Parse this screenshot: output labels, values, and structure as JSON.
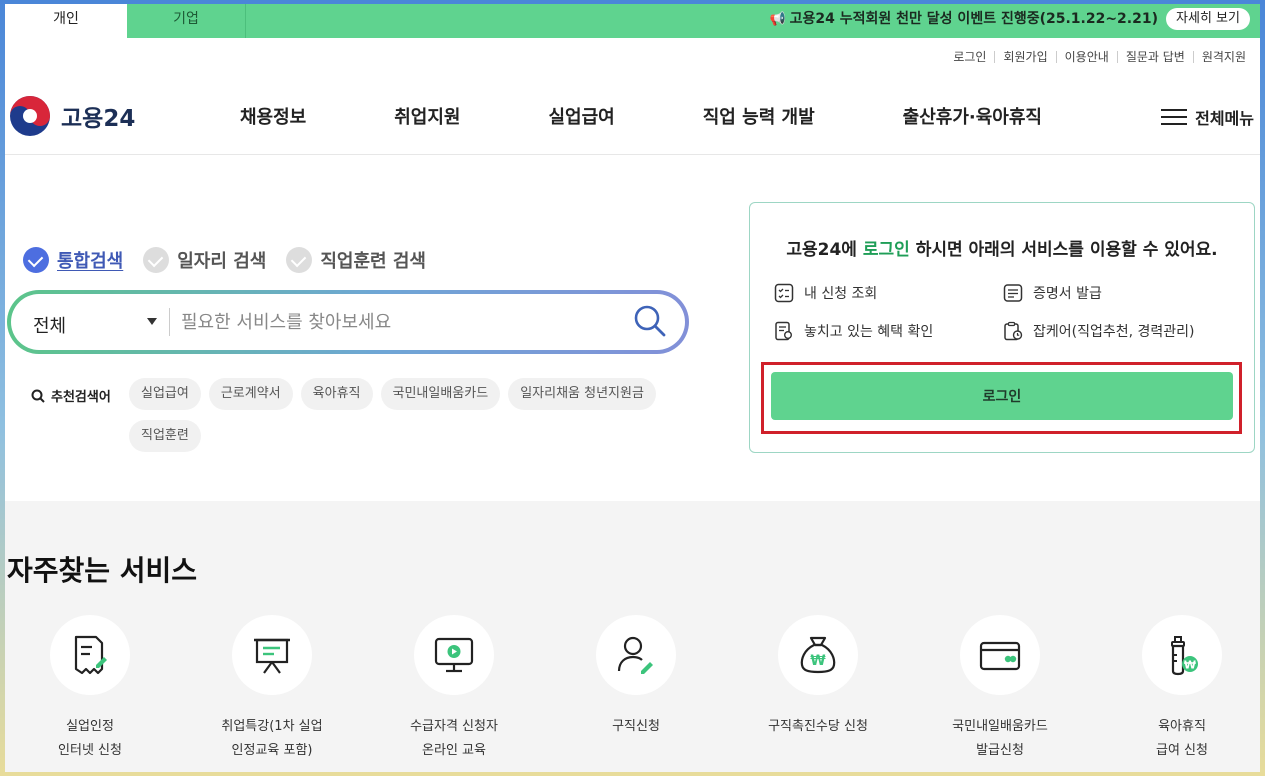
{
  "topbar": {
    "tab_person": "개인",
    "tab_company": "기업",
    "event_text": "고용24 누적회원 천만 달성 이벤트 진행중(25.1.22~2.21)",
    "event_button": "자세히 보기"
  },
  "util_links": [
    "로그인",
    "회원가입",
    "이용안내",
    "질문과 답변",
    "원격지원"
  ],
  "header": {
    "logo_text": "고용24",
    "nav": [
      "채용정보",
      "취업지원",
      "실업급여",
      "직업 능력 개발",
      "출산휴가·육아휴직"
    ],
    "menu_all": "전체메뉴"
  },
  "search": {
    "types": [
      {
        "label": "통합검색",
        "selected": true
      },
      {
        "label": "일자리 검색",
        "selected": false
      },
      {
        "label": "직업훈련 검색",
        "selected": false
      }
    ],
    "category": "전체",
    "placeholder": "필요한 서비스를 찾아보세요",
    "rec_label": "추천검색어",
    "keywords": [
      "실업급여",
      "근로계약서",
      "육아휴직",
      "국민내일배움카드",
      "일자리채움 청년지원금",
      "직업훈련"
    ]
  },
  "login_panel": {
    "msg_prefix": "고용24에 ",
    "msg_highlight": "로그인",
    "msg_suffix": " 하시면 아래의 서비스를 이용할 수 있어요.",
    "items": [
      "내 신청 조회",
      "증명서 발급",
      "놓치고 있는 혜택 확인",
      "잡케어(직업추천, 경력관리)"
    ],
    "button": "로그인"
  },
  "services": {
    "title": "자주찾는 서비스",
    "items": [
      {
        "line1": "실업인정",
        "line2": "인터넷 신청",
        "icon": "document-pen-icon"
      },
      {
        "line1": "취업특강(1차 실업",
        "line2": "인정교육 포함)",
        "icon": "presentation-board-icon"
      },
      {
        "line1": "수급자격 신청자",
        "line2": "온라인 교육",
        "icon": "monitor-play-icon"
      },
      {
        "line1": "구직신청",
        "line2": "",
        "icon": "person-pen-icon"
      },
      {
        "line1": "구직촉진수당 신청",
        "line2": "",
        "icon": "money-bag-icon"
      },
      {
        "line1": "국민내일배움카드",
        "line2": "발급신청",
        "icon": "card-icon"
      },
      {
        "line1": "육아휴직",
        "line2": "급여 신청",
        "icon": "baby-bottle-icon"
      }
    ]
  },
  "colors": {
    "brand_green": "#5fd38f",
    "accent_blue": "#4d6ee0",
    "highlight_red": "#d0202a"
  }
}
